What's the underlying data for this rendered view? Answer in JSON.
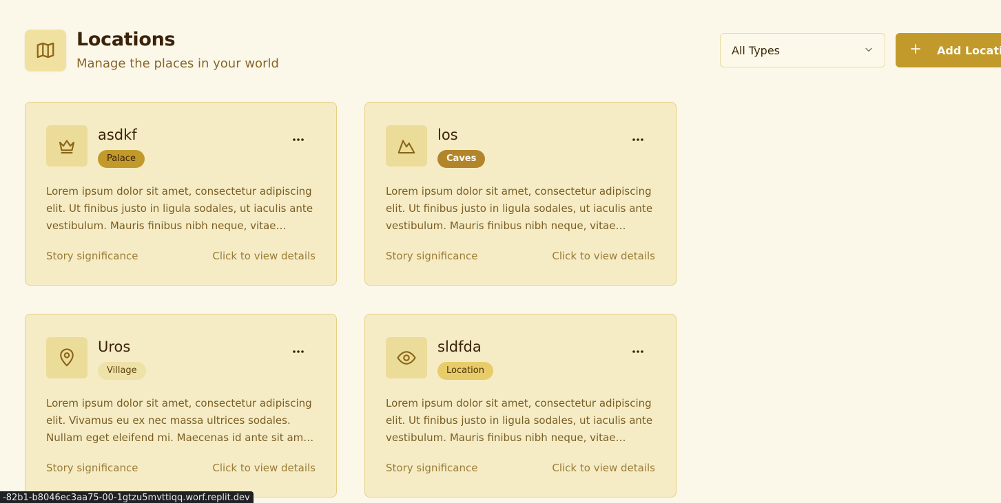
{
  "header": {
    "icon": "map-icon",
    "title": "Locations",
    "subtitle": "Manage the places in your world"
  },
  "filter": {
    "selected": "All Types"
  },
  "add_button": {
    "label": "Add Location"
  },
  "cards": [
    {
      "name": "asdkf",
      "icon": "crown-icon",
      "type": "Palace",
      "description": "Lorem ipsum dolor sit amet, consectetur adipiscing elit. Ut finibus justo in ligula sodales, ut iaculis ante vestibulum. Mauris finibus nibh neque, vitae sodales enim",
      "significance": "Story significance",
      "details": "Click to view details"
    },
    {
      "name": "los",
      "icon": "mountain-icon",
      "type": "Caves",
      "description": "Lorem ipsum dolor sit amet, consectetur adipiscing elit. Ut finibus justo in ligula sodales, ut iaculis ante vestibulum. Mauris finibus nibh neque, vitae sodales enim",
      "significance": "Story significance",
      "details": "Click to view details"
    },
    {
      "name": "Uros",
      "icon": "map-pin-icon",
      "type": "Village",
      "description": "Lorem ipsum dolor sit amet, consectetur adipiscing elit. Vivamus eu ex nec massa ultrices sodales. Nullam eget eleifend mi. Maecenas id ante sit amet nisi",
      "significance": "Story significance",
      "details": "Click to view details"
    },
    {
      "name": "sldfda",
      "icon": "eye-icon",
      "type": "Location",
      "description": "Lorem ipsum dolor sit amet, consectetur adipiscing elit. Ut finibus justo in ligula sodales, ut iaculis ante vestibulum. Mauris finibus nibh neque, vitae sodales enim",
      "significance": "Story significance",
      "details": "Click to view details"
    }
  ],
  "status_bar": {
    "url": "-82b1-b8046ec3aa75-00-1gtzu5mvttiqq.worf.replit.dev"
  },
  "colors": {
    "background": "#fcf8e9",
    "card": "#f5ecc6",
    "accent": "#c29a2c"
  }
}
